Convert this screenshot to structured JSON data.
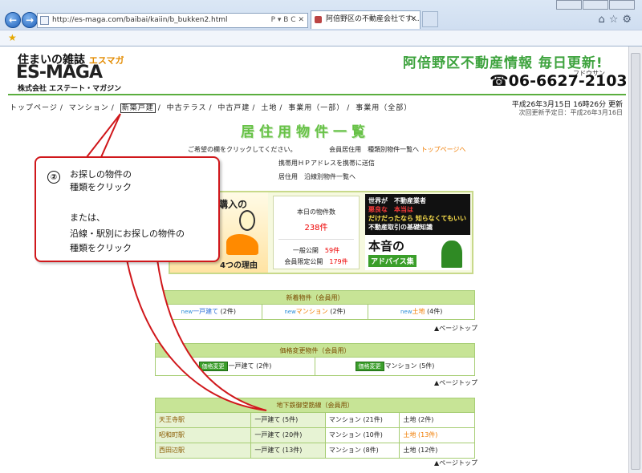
{
  "browser": {
    "url": "http://es-maga.com/baibai/kaiin/b_bukken2.html",
    "url_controls": "P ▾ B C ✕",
    "tab_title": "阿倍野区の不動産会社です...",
    "tab_close": "✕",
    "back_glyph": "←",
    "forward_glyph": "→",
    "tool_glyphs": "⌂☆⚙"
  },
  "header": {
    "logo_line1": "住まいの雑誌",
    "logo_kana": "エスマガ",
    "logo_main": "ES-MAGA",
    "company": "株式会社 エステート・マガジン",
    "headline": "阿倍野区不動産情報 毎日更新!",
    "tel_ruby": "フドウサン",
    "tel": "☎06-6627-2103",
    "date": "平成26年3月15日 16時26分 更新",
    "next_update": "次回更新予定日：平成26年3月16日"
  },
  "nav": {
    "items": [
      "トップページ",
      "マンション",
      "新築戸建",
      "中古テラス",
      "中古戸建",
      "土地",
      "事業用（一部）",
      "事業用（全部）"
    ],
    "separator": "/"
  },
  "page": {
    "title": "居住用物件一覧",
    "instruction": "ご希望の欄をクリックしてください。",
    "link_members": "会員居住用　種類別物件一覧へ",
    "link_top": "トップページへ",
    "mobile_link": "携帯用ＨＰアドレスを携帯に送信",
    "line_link": "居住用　沿線別物件一覧へ"
  },
  "promo": {
    "left_top": "購入の",
    "left_bottom": "4つの理由",
    "count_label": "本日の物件数",
    "count_value": "238件",
    "public_label": "一般公開",
    "public_value": "59件",
    "members_label": "会員限定公開",
    "members_value": "179件",
    "right_lines": [
      "世界が　不動産業者",
      "悪良な　本当は",
      "だけだったなら 知らなくてもいい",
      "不動産取引の基礎知識"
    ],
    "right_title": "本音の",
    "right_sub": "アドバイス集"
  },
  "new_section": {
    "title": "新着物件（会員用）",
    "new_tag": "new",
    "items": [
      {
        "label": "一戸建て",
        "count": "(2件)"
      },
      {
        "label": "マンション",
        "count": "(2件)"
      },
      {
        "label": "土地",
        "count": "(4件)"
      }
    ],
    "to_top": "▲ページトップ"
  },
  "price_section": {
    "title": "価格変更物件（会員用）",
    "badge": "価格変更",
    "items": [
      {
        "label": "一戸建て",
        "count": "(2件)"
      },
      {
        "label": "マンション",
        "count": "(5件)"
      }
    ],
    "to_top": "▲ページトップ"
  },
  "subway_section": {
    "title": "地下鉄御堂筋線（会員用）",
    "rows": [
      {
        "station": "天王寺駅",
        "house": "一戸建て (5件)",
        "mansion": "マンション (21件)",
        "land": "土地 (2件)"
      },
      {
        "station": "昭和町駅",
        "house": "一戸建て (20件)",
        "mansion": "マンション (10件)",
        "land": "土地 (13件)"
      },
      {
        "station": "西田辺駅",
        "house": "一戸建て (13件)",
        "mansion": "マンション (8件)",
        "land": "土地 (12件)"
      }
    ],
    "to_top": "▲ページトップ"
  },
  "callout": {
    "number": "②",
    "line1": "お探しの物件の",
    "line2": "種類をクリック",
    "line3": "または、",
    "line4": "沿線・駅別にお探しの物件の",
    "line5": "種類をクリック",
    "color": "#d0171b"
  }
}
